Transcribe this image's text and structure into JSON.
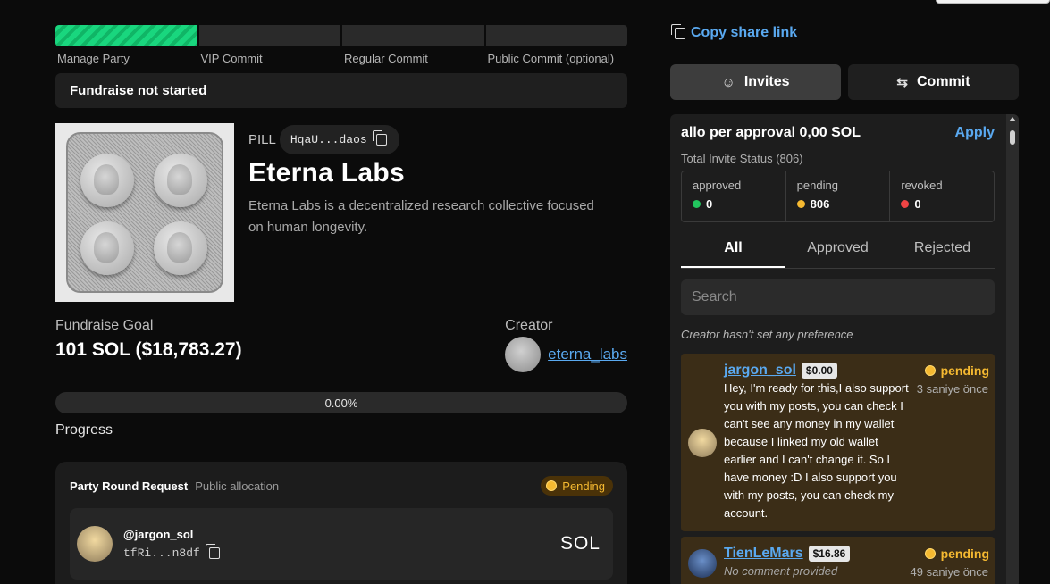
{
  "steps": [
    "Manage Party",
    "VIP Commit",
    "Regular Commit",
    "Public Commit (optional)"
  ],
  "status_banner": "Fundraise not started",
  "project": {
    "ticker": "PILL",
    "address": "HqaU...daos",
    "name": "Eterna Labs",
    "description": "Eterna Labs is a decentralized research collective focused on human longevity."
  },
  "goal": {
    "label": "Fundraise Goal",
    "value": "101 SOL ($18,783.27)"
  },
  "creator": {
    "label": "Creator",
    "name": "eterna_labs"
  },
  "progress": {
    "percent_text": "0.00%",
    "value": 0,
    "label": "Progress"
  },
  "round": {
    "title": "Party Round Request",
    "subtitle": "Public allocation",
    "status": "Pending",
    "handle": "@jargon_sol",
    "address": "tfRi...n8df",
    "amount": "SOL"
  },
  "share": {
    "label": "Copy share link"
  },
  "tabs": [
    {
      "label": "Invites",
      "icon": "user-icon"
    },
    {
      "label": "Commit",
      "icon": "swap-icon"
    }
  ],
  "panel": {
    "allo_text": "allo per approval 0,00 SOL",
    "apply_label": "Apply",
    "total_status": "Total Invite Status (806)",
    "stats": [
      {
        "label": "approved",
        "value": "0",
        "color": "#22c55e"
      },
      {
        "label": "pending",
        "value": "806",
        "color": "#f5b931"
      },
      {
        "label": "revoked",
        "value": "0",
        "color": "#ef4444"
      }
    ],
    "filters": [
      "All",
      "Approved",
      "Rejected"
    ],
    "search_placeholder": "Search",
    "preference": "Creator hasn't set any preference",
    "invites": [
      {
        "name": "jargon_sol",
        "amount": "$0.00",
        "status": "pending",
        "time": "3 saniye önce",
        "message": "Hey, I'm ready for this,I also support you with my posts, you can check I can't see any money in my wallet because I linked my old wallet earlier and I can't change it. So I have money :D I also support you with my posts, you can check my account."
      },
      {
        "name": "TienLeMars",
        "amount": "$16.86",
        "status": "pending",
        "time": "49 saniye önce",
        "message": "No comment provided"
      }
    ]
  }
}
